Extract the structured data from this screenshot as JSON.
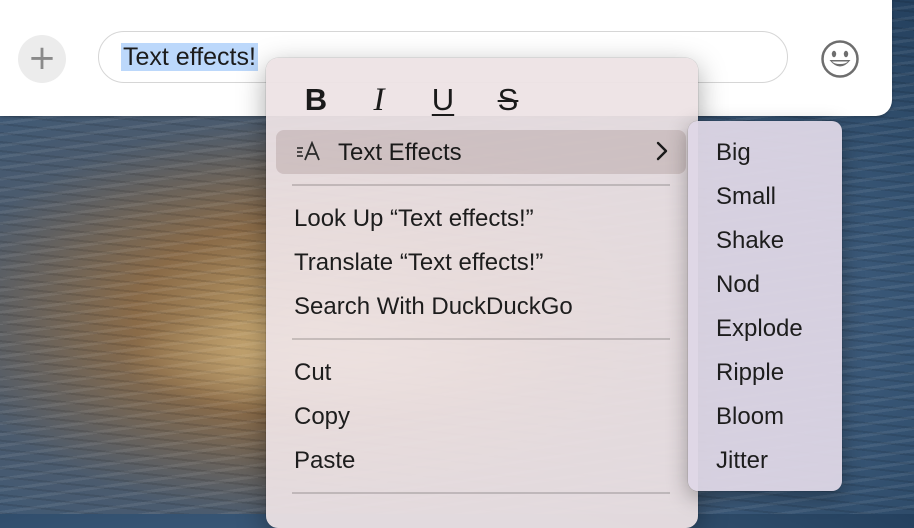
{
  "composer": {
    "add_button_glyph": "+",
    "text_value": "Text effects!",
    "emoji_icon": "smiley-face-icon"
  },
  "context_menu": {
    "format_buttons": {
      "bold": "B",
      "italic": "I",
      "underline": "U",
      "strikethrough": "S"
    },
    "text_effects_icon": "text-effects-icon",
    "text_effects_label": "Text Effects",
    "look_up": "Look Up “Text effects!”",
    "translate": "Translate “Text effects!”",
    "search": "Search With DuckDuckGo",
    "cut": "Cut",
    "copy": "Copy",
    "paste": "Paste"
  },
  "effects_submenu": {
    "items": [
      "Big",
      "Small",
      "Shake",
      "Nod",
      "Explode",
      "Ripple",
      "Bloom",
      "Jitter"
    ]
  },
  "colors": {
    "selection": "#bcd8fb",
    "menu_background": "#ede2e4",
    "submenu_background": "#ded7e6"
  }
}
